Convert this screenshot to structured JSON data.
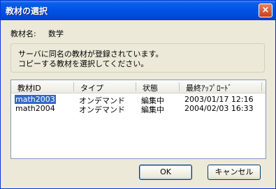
{
  "window": {
    "title": "教材の選択",
    "close_icon": "×"
  },
  "course": {
    "label": "教材名:",
    "value": "数学"
  },
  "message": {
    "line1": "サーバに同名の教材が登録されています。",
    "line2": "コピーする教材を選択してください。"
  },
  "table": {
    "columns": [
      "教材ID",
      "タイプ",
      "状態",
      "最終ｱｯﾌﾟﾛｰﾄﾞ"
    ],
    "rows": [
      [
        "math2003",
        "オンデマンド",
        "編集中",
        "2003/01/17 12:16"
      ],
      [
        "math2004",
        "オンデマンド",
        "編集中",
        "2004/02/03 16:33"
      ]
    ],
    "selected_row": 0
  },
  "buttons": {
    "ok": "OK",
    "cancel": "キャンセル"
  }
}
